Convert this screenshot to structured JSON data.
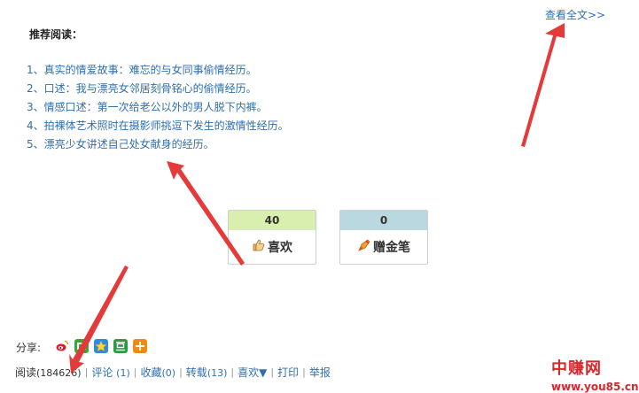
{
  "header": {
    "view_full_label": "查看全文>>"
  },
  "recommend": {
    "title": "推荐阅读：",
    "items": [
      "1、真实的情爱故事：难忘的与女同事偷情经历。",
      "2、口述：我与漂亮女邻居刻骨铭心的偷情经历。",
      "3、情感口述：第一次给老公以外的男人脱下内裤。",
      "4、拍裸体艺术照时在摄影师挑逗下发生的激情性经历。",
      "5、漂亮少女讲述自己处女献身的经历。"
    ]
  },
  "votes": {
    "like": {
      "count": "40",
      "label": "喜欢",
      "icon": "thumbs-up-icon"
    },
    "pen": {
      "count": "0",
      "label": "赠金笔",
      "icon": "gold-pen-icon"
    }
  },
  "share": {
    "label": "分享:",
    "icons": [
      "weibo-icon",
      "green-share-icon",
      "star-share-icon",
      "douban-icon",
      "more-share-icon"
    ]
  },
  "bottom_bar": {
    "read_label": "阅读",
    "read_count": "(184626)",
    "comment_label": "评论",
    "comment_count": "(1)",
    "favorite_label": "收藏",
    "favorite_count": "(0)",
    "repost_label": "转载",
    "repost_count": "(13)",
    "like_label": "喜欢▼",
    "print_label": "打印",
    "report_label": "举报"
  },
  "watermark": {
    "cn": "中赚网",
    "url": "www.you85.cn"
  },
  "colors": {
    "link": "#2f6fb0",
    "arrow": "#e43a3a",
    "like_count_bg": "#d9efb0",
    "pen_count_bg": "#b9d8df"
  }
}
